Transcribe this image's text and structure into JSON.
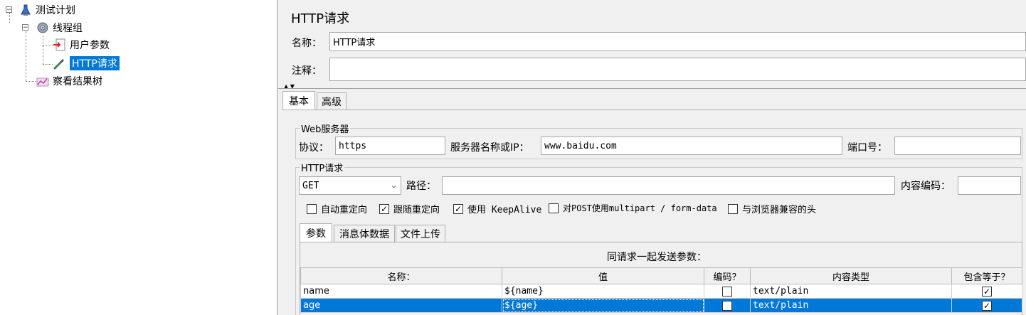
{
  "tree": {
    "items": [
      {
        "label": "测试计划",
        "icon": "test-plan-icon"
      },
      {
        "label": "线程组",
        "icon": "gear-icon"
      },
      {
        "label": "用户参数",
        "icon": "user-params-icon"
      },
      {
        "label": "HTTP请求",
        "icon": "pipette-icon",
        "selected": true
      },
      {
        "label": "察看结果树",
        "icon": "chart-icon"
      }
    ]
  },
  "panel": {
    "title": "HTTP请求",
    "name_label": "名称：",
    "name_value": "HTTP请求",
    "comment_label": "注释：",
    "comment_value": ""
  },
  "tabs": [
    "基本",
    "高级"
  ],
  "web_server": {
    "legend": "Web服务器",
    "protocol_label": "协议：",
    "protocol_value": "https",
    "server_label": "服务器名称或IP：",
    "server_value": "www.baidu.com",
    "port_label": "端口号：",
    "port_value": ""
  },
  "http_request": {
    "legend": "HTTP请求",
    "method": "GET",
    "path_label": "路径：",
    "path_value": "",
    "encoding_label": "内容编码：",
    "encoding_value": "",
    "checkboxes": [
      {
        "label": "自动重定向",
        "checked": false
      },
      {
        "label": "跟随重定向",
        "checked": true
      },
      {
        "label": "使用 KeepAlive",
        "checked": true
      },
      {
        "label": "对POST使用multipart / form-data",
        "checked": false
      },
      {
        "label": "与浏览器兼容的头",
        "checked": false
      }
    ]
  },
  "subtabs": [
    "参数",
    "消息体数据",
    "文件上传"
  ],
  "params": {
    "caption": "同请求一起发送参数：",
    "headers": [
      "名称：",
      "值",
      "编码？",
      "内容类型",
      "包含等于？"
    ],
    "rows": [
      {
        "name": "name",
        "value": "${name}",
        "encode": false,
        "content_type": "text/plain",
        "include_equals": true
      },
      {
        "name": "age",
        "value": "${age}",
        "encode": false,
        "content_type": "text/plain",
        "include_equals": true,
        "selected": true
      }
    ]
  },
  "colors": {
    "selection": "#0078d7",
    "panel_bg": "#f0f0f0"
  }
}
